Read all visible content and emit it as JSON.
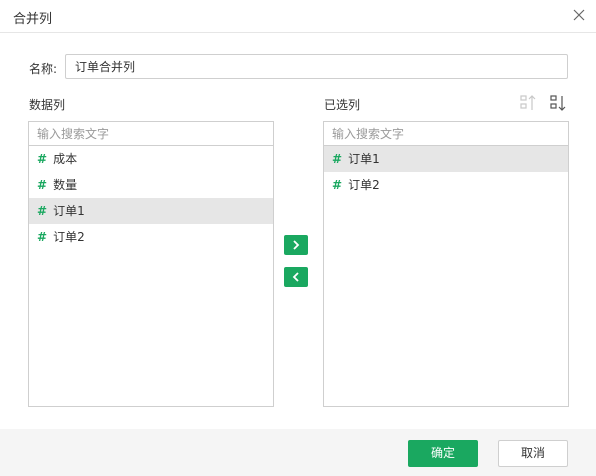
{
  "dialog": {
    "title": "合并列",
    "name_label": "名称:",
    "name_value": "订单合并列"
  },
  "left_panel": {
    "title": "数据列",
    "search_placeholder": "输入搜索文字",
    "items": [
      {
        "icon": "#",
        "label": "成本",
        "selected": false
      },
      {
        "icon": "#",
        "label": "数量",
        "selected": false
      },
      {
        "icon": "#",
        "label": "订单1",
        "selected": true
      },
      {
        "icon": "#",
        "label": "订单2",
        "selected": false
      }
    ]
  },
  "right_panel": {
    "title": "已选列",
    "search_placeholder": "输入搜索文字",
    "items": [
      {
        "icon": "#",
        "label": "订单1",
        "selected": true
      },
      {
        "icon": "#",
        "label": "订单2",
        "selected": false
      }
    ]
  },
  "footer": {
    "ok_label": "确定",
    "cancel_label": "取消"
  },
  "colors": {
    "accent": "#1aa860",
    "selected_row": "#e6e6e6",
    "border": "#cfcfcf"
  },
  "icons": {
    "close": "close-icon",
    "sort_asc": "sort-ascending-icon",
    "sort_desc": "sort-descending-icon",
    "move_right": "chevron-right-icon",
    "move_left": "chevron-left-icon"
  }
}
